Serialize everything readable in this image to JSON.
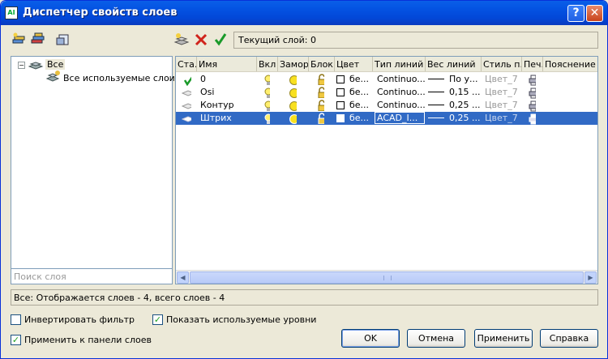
{
  "title": "Диспетчер свойств слоев",
  "current_layer": "Текущий слой: 0",
  "tree": {
    "root": "Все",
    "child": "Все используемые слои"
  },
  "search_placeholder": "Поиск слоя",
  "columns": [
    "Ста...",
    "Имя",
    "Вкл",
    "Замор...",
    "Блок...",
    "Цвет",
    "Тип линий",
    "Вес линий",
    "Стиль п...",
    "Печ...",
    "Пояснение"
  ],
  "layers": [
    {
      "name": "0",
      "color": "бе...",
      "linetype": "Continuo...",
      "weight": "По у...",
      "plot_style": "Цвет_7",
      "status": "current",
      "selected": false
    },
    {
      "name": "Osi",
      "color": "бе...",
      "linetype": "Continuo...",
      "weight": "0,15 ...",
      "plot_style": "Цвет_7",
      "status": "layer",
      "selected": false
    },
    {
      "name": "Контур",
      "color": "бе...",
      "linetype": "Continuo...",
      "weight": "0,25 ...",
      "plot_style": "Цвет_7",
      "status": "layer",
      "selected": false
    },
    {
      "name": "Штрих",
      "color": "бе...",
      "linetype": "ACAD_I...",
      "weight": "0,25 ...",
      "plot_style": "Цвет_7",
      "status": "layer",
      "selected": true
    }
  ],
  "status_text": "Все: Отображается слоев - 4, всего слоев - 4",
  "checkboxes": {
    "invert_filter": {
      "label": "Инвертировать фильтр",
      "checked": false
    },
    "show_used": {
      "label": "Показать используемые уровни",
      "checked": true
    },
    "apply_panel": {
      "label": "Применить к панели слоев",
      "checked": true
    }
  },
  "buttons": {
    "ok": "OK",
    "cancel": "Отмена",
    "apply": "Применить",
    "help": "Справка"
  },
  "icons": {
    "help": "help-icon",
    "close": "close-icon"
  }
}
